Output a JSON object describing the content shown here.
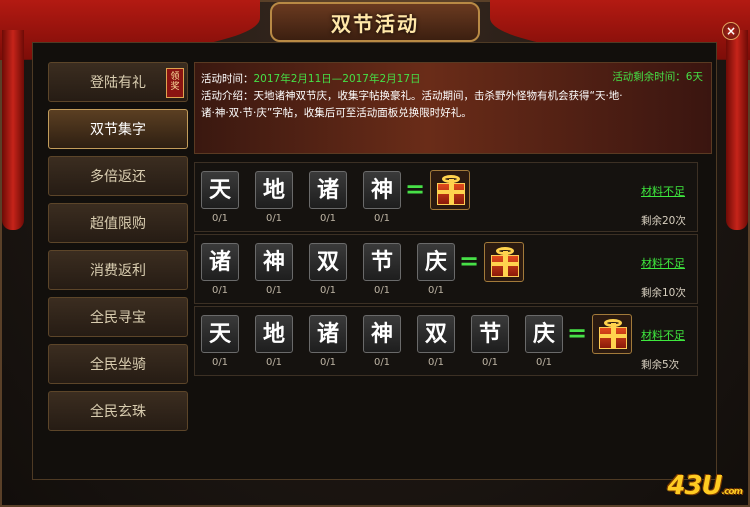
{
  "window": {
    "title": "双节活动",
    "close_glyph": "×"
  },
  "menu": {
    "items": [
      {
        "label": "登陆有礼",
        "badge": "领奖"
      },
      {
        "label": "双节集字",
        "active": true
      },
      {
        "label": "多倍返还"
      },
      {
        "label": "超值限购"
      },
      {
        "label": "消费返利"
      },
      {
        "label": "全民寻宝"
      },
      {
        "label": "全民坐骑"
      },
      {
        "label": "全民玄珠"
      }
    ]
  },
  "banner": {
    "time_label": "活动时间：",
    "time_value": "2017年2月11日—2017年2月17日",
    "remain_label": "活动剩余时间：6天",
    "intro_line1": "活动介绍：天地诸神双节庆，收集字帖换豪礼。活动期间，击杀野外怪物有机会获得“天·地·",
    "intro_line2": "诸·神·双·节·庆”字帖，收集后可至活动面板兑换限时好礼。"
  },
  "rows": [
    {
      "chars": [
        "天",
        "地",
        "诸",
        "神"
      ],
      "counts": [
        "0/1",
        "0/1",
        "0/1",
        "0/1"
      ],
      "eq": "=",
      "status": "材料不足",
      "remain": "剩余20次"
    },
    {
      "chars": [
        "诸",
        "神",
        "双",
        "节",
        "庆"
      ],
      "counts": [
        "0/1",
        "0/1",
        "0/1",
        "0/1",
        "0/1"
      ],
      "eq": "=",
      "status": "材料不足",
      "remain": "剩余10次"
    },
    {
      "chars": [
        "天",
        "地",
        "诸",
        "神",
        "双",
        "节",
        "庆"
      ],
      "counts": [
        "0/1",
        "0/1",
        "0/1",
        "0/1",
        "0/1",
        "0/1",
        "0/1"
      ],
      "eq": "=",
      "status": "材料不足",
      "remain": "剩余5次"
    }
  ],
  "logo": {
    "text": "43U",
    "suffix": ".com"
  },
  "colors": {
    "accent_green": "#46e046",
    "gold": "#ffe7a8",
    "curtain_red": "#b31a12"
  }
}
